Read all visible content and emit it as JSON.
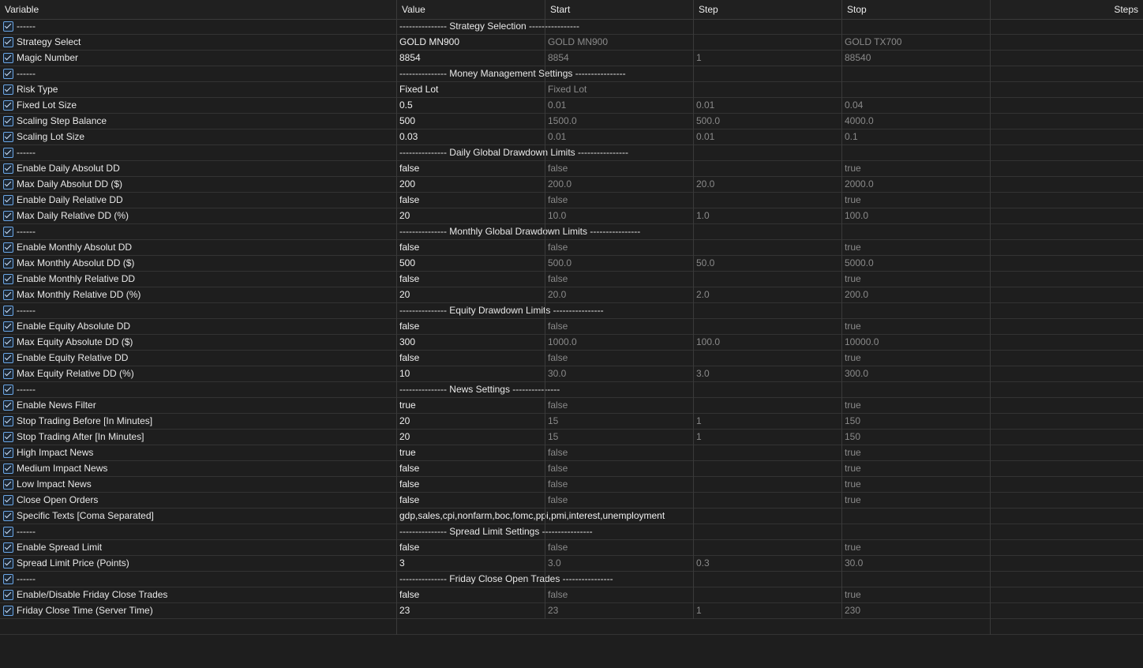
{
  "columns": {
    "variable": "Variable",
    "value": "Value",
    "start": "Start",
    "step": "Step",
    "stop": "Stop",
    "steps": "Steps"
  },
  "colors": {
    "background": "#1e1e1e",
    "checkbox_border": "#6aa6e6",
    "dim_text": "#8a8a8a"
  },
  "rows": [
    {
      "type": "sep",
      "checked": true,
      "name": "------",
      "label": "--------------- Strategy Selection ----------------"
    },
    {
      "type": "param",
      "checked": true,
      "name": "Strategy Select",
      "value": "GOLD MN900",
      "start": "GOLD MN900",
      "step": "",
      "stop": "GOLD TX700"
    },
    {
      "type": "param",
      "checked": true,
      "name": "Magic Number",
      "value": "8854",
      "start": "8854",
      "step": "1",
      "stop": "88540"
    },
    {
      "type": "sep",
      "checked": true,
      "name": "------",
      "label": "--------------- Money Management Settings ----------------"
    },
    {
      "type": "param",
      "checked": true,
      "name": "Risk Type",
      "value": "Fixed Lot",
      "start": "Fixed Lot",
      "step": "",
      "stop": ""
    },
    {
      "type": "param",
      "checked": true,
      "name": "Fixed Lot Size",
      "value": "0.5",
      "start": "0.01",
      "step": "0.01",
      "stop": "0.04"
    },
    {
      "type": "param",
      "checked": true,
      "name": "Scaling Step Balance",
      "value": "500",
      "start": "1500.0",
      "step": "500.0",
      "stop": "4000.0"
    },
    {
      "type": "param",
      "checked": true,
      "name": "Scaling Lot Size",
      "value": "0.03",
      "start": "0.01",
      "step": "0.01",
      "stop": "0.1"
    },
    {
      "type": "sep",
      "checked": true,
      "name": "------",
      "label": "--------------- Daily Global Drawdown Limits ----------------"
    },
    {
      "type": "param",
      "checked": true,
      "name": "Enable Daily Absolut DD",
      "value": "false",
      "start": "false",
      "step": "",
      "stop": "true"
    },
    {
      "type": "param",
      "checked": true,
      "name": "Max Daily Absolut DD ($)",
      "value": "200",
      "start": "200.0",
      "step": "20.0",
      "stop": "2000.0"
    },
    {
      "type": "param",
      "checked": true,
      "name": "Enable Daily Relative DD",
      "value": "false",
      "start": "false",
      "step": "",
      "stop": "true"
    },
    {
      "type": "param",
      "checked": true,
      "name": "Max Daily Relative DD (%)",
      "value": "20",
      "start": "10.0",
      "step": "1.0",
      "stop": "100.0"
    },
    {
      "type": "sep",
      "checked": true,
      "name": "------",
      "label": "--------------- Monthly Global Drawdown Limits ----------------"
    },
    {
      "type": "param",
      "checked": true,
      "name": "Enable Monthly Absolut DD",
      "value": "false",
      "start": "false",
      "step": "",
      "stop": "true"
    },
    {
      "type": "param",
      "checked": true,
      "name": "Max Monthly Absolut DD ($)",
      "value": "500",
      "start": "500.0",
      "step": "50.0",
      "stop": "5000.0"
    },
    {
      "type": "param",
      "checked": true,
      "name": "Enable Monthly Relative DD",
      "value": "false",
      "start": "false",
      "step": "",
      "stop": "true"
    },
    {
      "type": "param",
      "checked": true,
      "name": "Max Monthly Relative DD (%)",
      "value": "20",
      "start": "20.0",
      "step": "2.0",
      "stop": "200.0"
    },
    {
      "type": "sep",
      "checked": true,
      "name": "------",
      "label": "--------------- Equity Drawdown Limits ----------------"
    },
    {
      "type": "param",
      "checked": true,
      "name": "Enable Equity Absolute DD",
      "value": "false",
      "start": "false",
      "step": "",
      "stop": "true"
    },
    {
      "type": "param",
      "checked": true,
      "name": "Max Equity Absolute DD ($)",
      "value": "300",
      "start": "1000.0",
      "step": "100.0",
      "stop": "10000.0"
    },
    {
      "type": "param",
      "checked": true,
      "name": "Enable Equity Relative DD",
      "value": "false",
      "start": "false",
      "step": "",
      "stop": "true"
    },
    {
      "type": "param",
      "checked": true,
      "name": "Max Equity Relative DD (%)",
      "value": "10",
      "start": "30.0",
      "step": "3.0",
      "stop": "300.0"
    },
    {
      "type": "sep",
      "checked": true,
      "name": "------",
      "label": "--------------- News Settings ---------------"
    },
    {
      "type": "param",
      "checked": true,
      "name": "Enable News Filter",
      "value": "true",
      "start": "false",
      "step": "",
      "stop": "true"
    },
    {
      "type": "param",
      "checked": true,
      "name": "Stop Trading Before [In Minutes]",
      "value": "20",
      "start": "15",
      "step": "1",
      "stop": "150"
    },
    {
      "type": "param",
      "checked": true,
      "name": "Stop Trading After [In Minutes]",
      "value": "20",
      "start": "15",
      "step": "1",
      "stop": "150"
    },
    {
      "type": "param",
      "checked": true,
      "name": "High Impact News",
      "value": "true",
      "start": "false",
      "step": "",
      "stop": "true"
    },
    {
      "type": "param",
      "checked": true,
      "name": "Medium Impact News",
      "value": "false",
      "start": "false",
      "step": "",
      "stop": "true"
    },
    {
      "type": "param",
      "checked": true,
      "name": "Low Impact News",
      "value": "false",
      "start": "false",
      "step": "",
      "stop": "true"
    },
    {
      "type": "param",
      "checked": true,
      "name": "Close Open Orders",
      "value": "false",
      "start": "false",
      "step": "",
      "stop": "true"
    },
    {
      "type": "text",
      "checked": true,
      "name": "Specific Texts [Coma Separated]",
      "value": "gdp,sales,cpi,nonfarm,boc,fomc,ppi,pmi,interest,unemployment"
    },
    {
      "type": "sep",
      "checked": true,
      "name": "------",
      "label": "--------------- Spread Limit Settings ----------------"
    },
    {
      "type": "param",
      "checked": true,
      "name": "Enable Spread Limit",
      "value": "false",
      "start": "false",
      "step": "",
      "stop": "true"
    },
    {
      "type": "param",
      "checked": true,
      "name": "Spread Limit Price (Points)",
      "value": "3",
      "start": "3.0",
      "step": "0.3",
      "stop": "30.0"
    },
    {
      "type": "sep",
      "checked": true,
      "name": "------",
      "label": "--------------- Friday Close Open Trades ----------------"
    },
    {
      "type": "param",
      "checked": true,
      "name": "Enable/Disable Friday Close Trades",
      "value": "false",
      "start": "false",
      "step": "",
      "stop": "true"
    },
    {
      "type": "param",
      "checked": true,
      "name": "Friday Close Time (Server Time)",
      "value": "23",
      "start": "23",
      "step": "1",
      "stop": "230"
    }
  ]
}
